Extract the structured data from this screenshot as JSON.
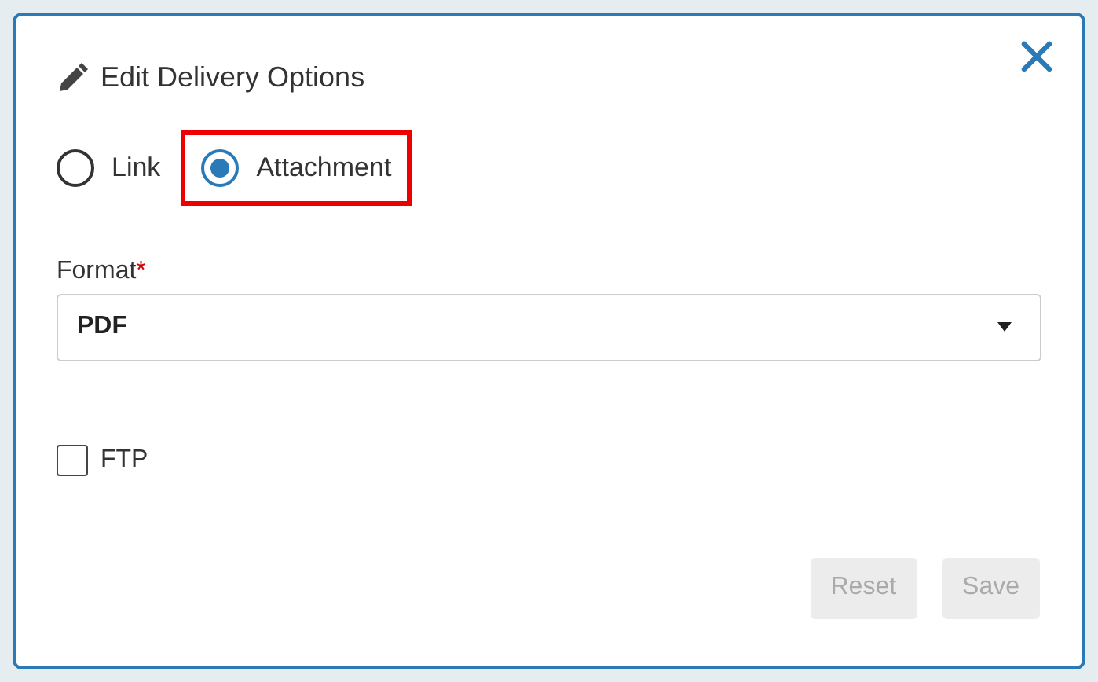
{
  "dialog": {
    "title": "Edit Delivery Options"
  },
  "delivery": [
    {
      "label": "Link",
      "selected": false,
      "highlighted": false
    },
    {
      "label": "Attachment",
      "selected": true,
      "highlighted": true
    }
  ],
  "format": {
    "label": "Format",
    "required_mark": "*",
    "value": "PDF"
  },
  "ftp": {
    "label": "FTP",
    "checked": false
  },
  "buttons": [
    {
      "label": "Reset",
      "disabled": true
    },
    {
      "label": "Save",
      "disabled": true
    }
  ]
}
